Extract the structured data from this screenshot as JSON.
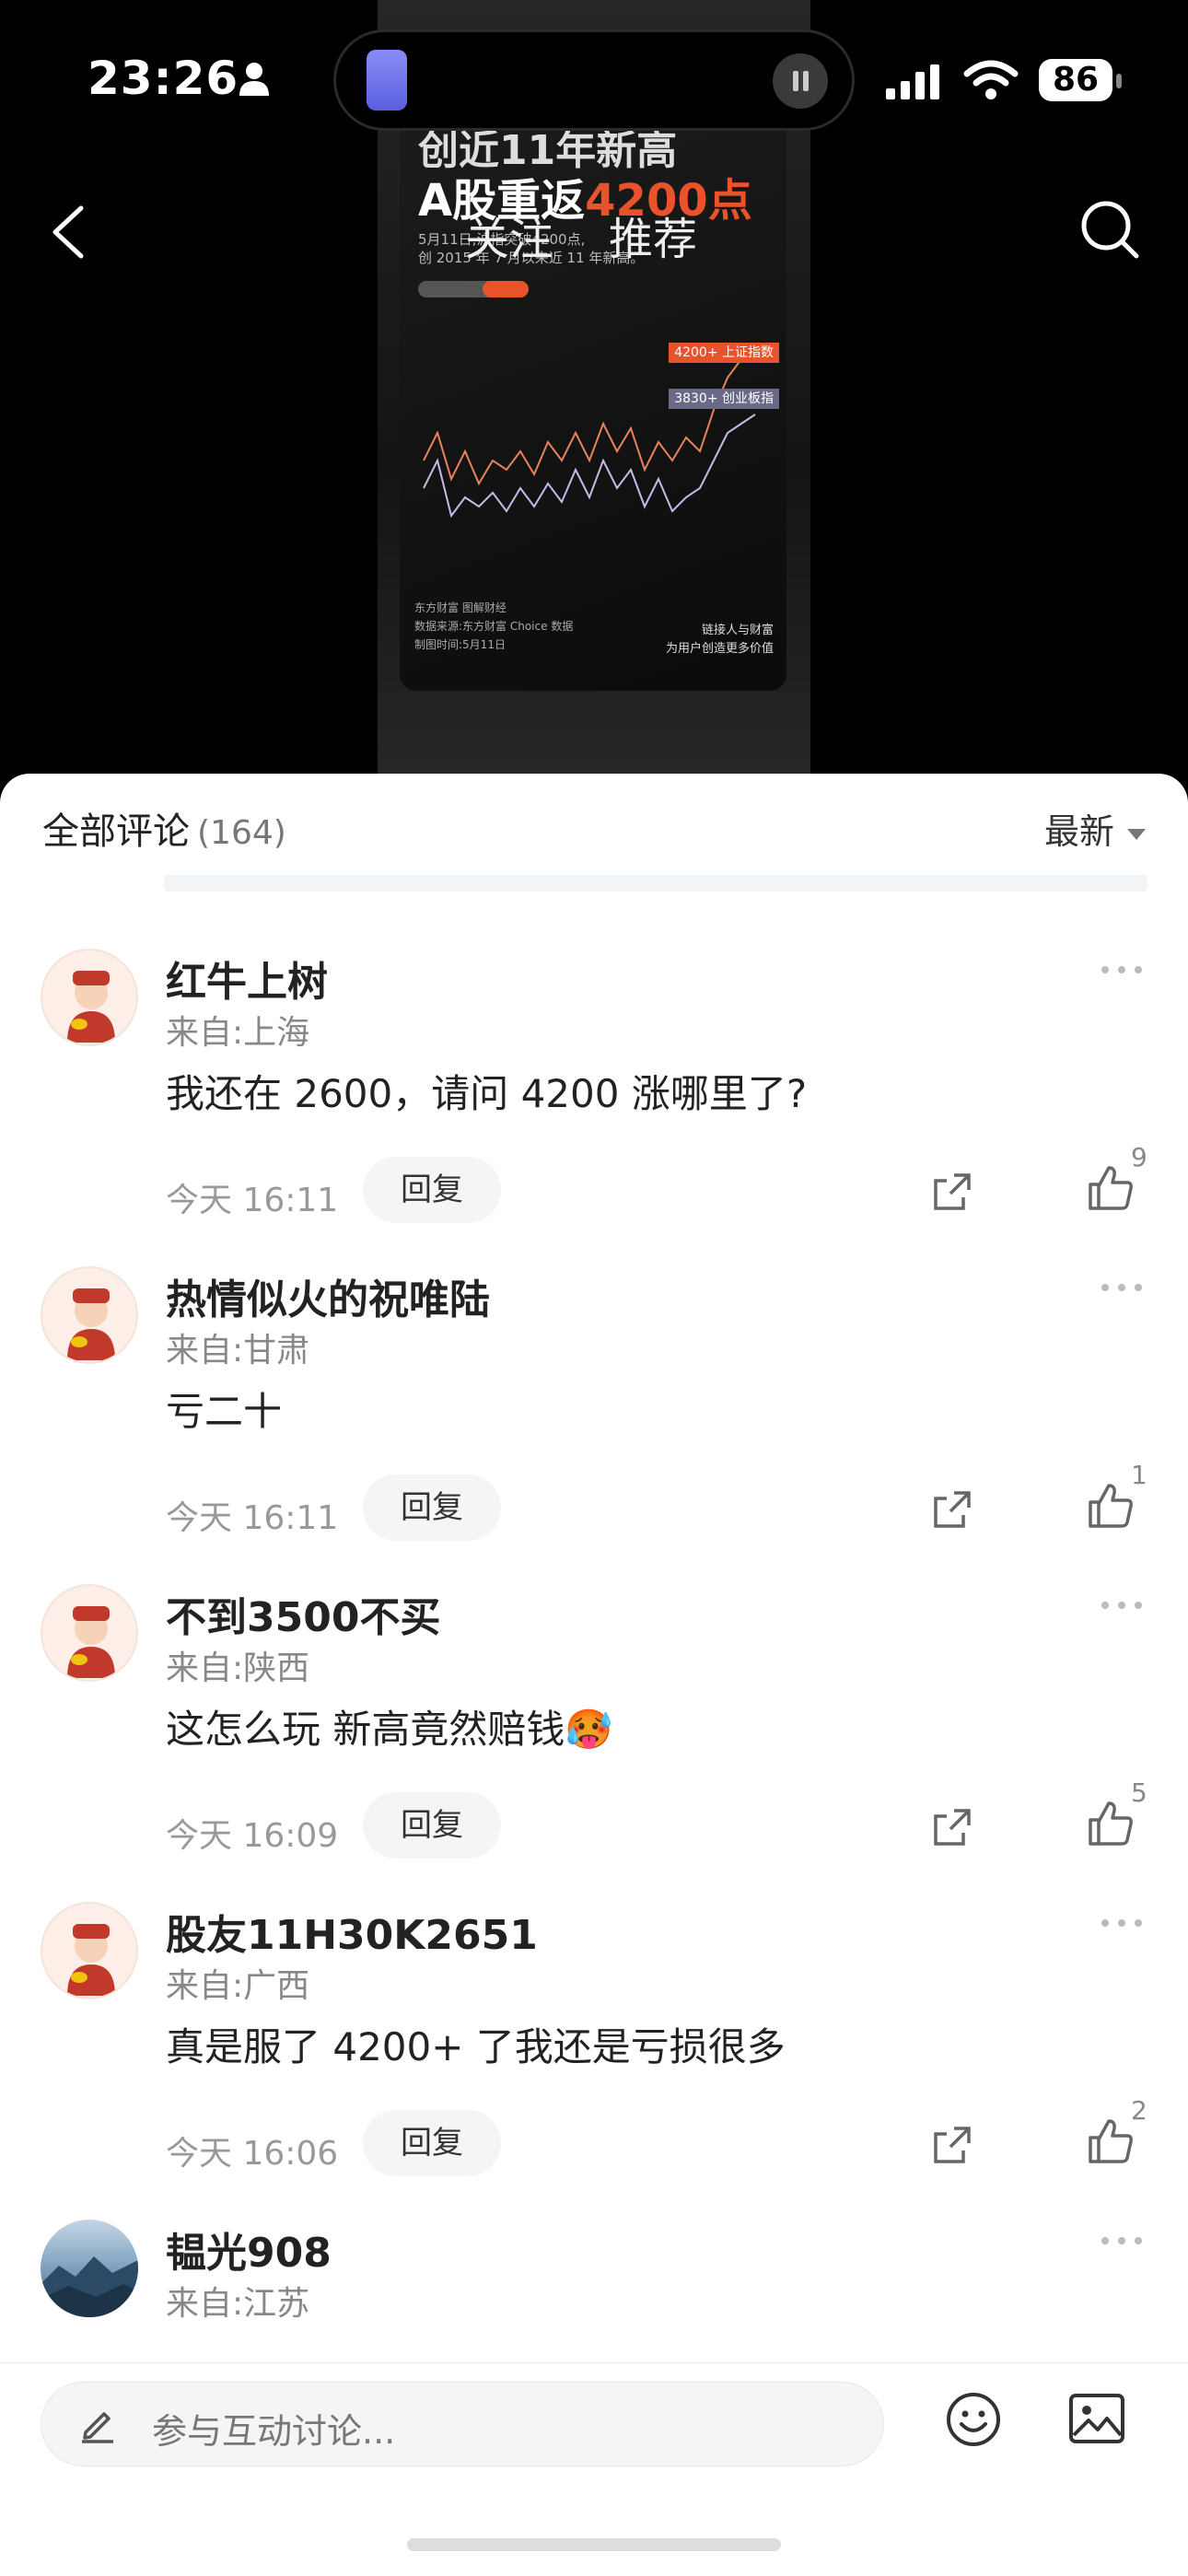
{
  "status": {
    "time": "23:26",
    "battery": "86"
  },
  "poster": {
    "headline1": "创近11年新高",
    "headline2_prefix": "A股重返",
    "headline2_highlight": "4200点",
    "sub1": "5月11日,沪指突破4200点,",
    "sub2": "创 2015 年 7 月以来近 11 年新高。",
    "tag1": "4200+ 上证指数",
    "tag2": "3830+ 创业板指",
    "footer1": "东方财富 图解财经",
    "footer2": "数据来源:东方财富 Choice 数据",
    "footer3": "制图时间:5月11日",
    "slogan1": "链接人与财富",
    "slogan2": "为用户创造更多价值",
    "tab_follow": "关注",
    "tab_recommend": "推荐"
  },
  "sheet": {
    "title": "全部评论",
    "count": "(164)",
    "sort_label": "最新"
  },
  "comments": [
    {
      "username": "红牛上树",
      "location": "来自:上海",
      "content": "我还在 2600，请问 4200 涨哪里了?",
      "time": "今天 16:11",
      "reply": "回复",
      "likes": "9"
    },
    {
      "username": "热情似火的祝唯陆",
      "location": "来自:甘肃",
      "content": "亏二十",
      "time": "今天 16:11",
      "reply": "回复",
      "likes": "1"
    },
    {
      "username": "不到3500不买",
      "location": "来自:陕西",
      "content": "这怎么玩 新高竟然赔钱🥵",
      "time": "今天 16:09",
      "reply": "回复",
      "likes": "5"
    },
    {
      "username": "股友11H30K2651",
      "location": "来自:广西",
      "content": "真是服了 4200+ 了我还是亏损很多",
      "time": "今天 16:06",
      "reply": "回复",
      "likes": "2"
    },
    {
      "username": "韫光908",
      "location": "来自:江苏",
      "content": "",
      "time": "",
      "reply": "",
      "likes": ""
    }
  ],
  "input": {
    "placeholder": "参与互动讨论..."
  }
}
